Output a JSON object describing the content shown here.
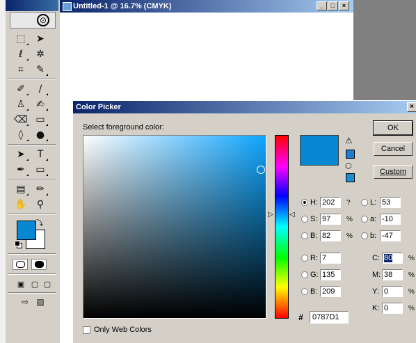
{
  "document": {
    "title": "Untitled-1 @ 16.7% (CMYK)",
    "buttons": {
      "minimize": "_",
      "maximize": "□",
      "close": "×"
    }
  },
  "toolbox": {
    "colors": {
      "foreground": "#0787d1",
      "background": "#ffffff"
    },
    "tools": [
      "marquee-tool",
      "move-tool",
      "lasso-tool",
      "magic-wand-tool",
      "crop-tool",
      "slice-tool",
      "healing-brush-tool",
      "brush-tool",
      "clone-stamp-tool",
      "history-brush-tool",
      "eraser-tool",
      "gradient-tool",
      "blur-tool",
      "dodge-tool",
      "path-selection-tool",
      "type-tool",
      "pen-tool",
      "shape-tool",
      "notes-tool",
      "eyedropper-tool",
      "hand-tool",
      "zoom-tool"
    ]
  },
  "dialog": {
    "title": "Color Picker",
    "close": "×",
    "prompt": "Select foreground color:",
    "buttons": {
      "ok": "OK",
      "cancel": "Cancel",
      "custom": "Custom"
    },
    "preview_color": "#0787d1",
    "fields": {
      "H": {
        "label": "H:",
        "value": "202",
        "unit": "?",
        "selected": true
      },
      "S": {
        "label": "S:",
        "value": "97",
        "unit": "%"
      },
      "B": {
        "label": "B:",
        "value": "82",
        "unit": "%"
      },
      "R": {
        "label": "R:",
        "value": "7"
      },
      "G": {
        "label": "G:",
        "value": "135"
      },
      "Bl": {
        "label": "B:",
        "value": "209"
      },
      "L": {
        "label": "L:",
        "value": "53"
      },
      "a": {
        "label": "a:",
        "value": "-10"
      },
      "b": {
        "label": "b:",
        "value": "-47"
      },
      "C": {
        "label": "C:",
        "value": "80",
        "unit": "%"
      },
      "M": {
        "label": "M:",
        "value": "38",
        "unit": "%"
      },
      "Y": {
        "label": "Y:",
        "value": "0",
        "unit": "%"
      },
      "K": {
        "label": "K:",
        "value": "0",
        "unit": "%"
      }
    },
    "hash": "#",
    "hex": "0787D1",
    "web_colors_label": "Only Web Colors",
    "gamut_warning_icon": "warning-triangle-icon",
    "web_safe_icon": "cube-icon"
  }
}
